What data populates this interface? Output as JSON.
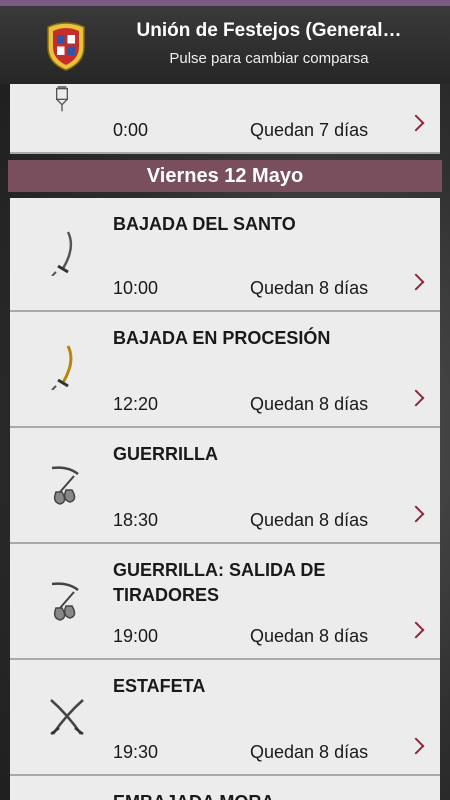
{
  "header": {
    "title": "Unión de Festejos (General…",
    "subtitle": "Pulse para cambiar comparsa",
    "logo": "shield-logo"
  },
  "colors": {
    "accent": "#7a4f5d",
    "chevron": "#8a2a3a",
    "card": "#ececec"
  },
  "top_item": {
    "icon": "lantern-icon",
    "time": "0:00",
    "remaining": "Quedan 7 días"
  },
  "day_header": "Viernes 12 Mayo",
  "events": [
    {
      "name": "BAJADA DEL SANTO",
      "time": "10:00",
      "remaining": "Quedan 8 días",
      "icon": "scimitar-icon"
    },
    {
      "name": "BAJADA EN PROCESIÓN",
      "time": "12:20",
      "remaining": "Quedan 8 días",
      "icon": "gold-scimitar-icon"
    },
    {
      "name": "GUERRILLA",
      "time": "18:30",
      "remaining": "Quedan 8 días",
      "icon": "blunderbuss-icon"
    },
    {
      "name": "GUERRILLA: SALIDA DE TIRADORES",
      "time": "19:00",
      "remaining": "Quedan 8 días",
      "icon": "blunderbuss-icon"
    },
    {
      "name": "ESTAFETA",
      "time": "19:30",
      "remaining": "Quedan 8 días",
      "icon": "crossed-swords-icon"
    },
    {
      "name": "EMBAJADA MORA",
      "time": "",
      "remaining": "",
      "icon": ""
    }
  ]
}
